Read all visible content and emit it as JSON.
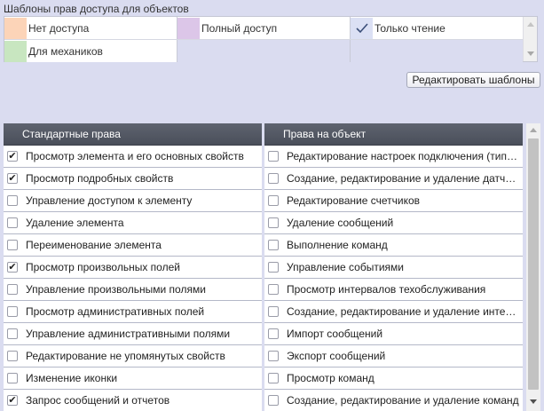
{
  "templates_section": {
    "title": "Шаблоны прав доступа для объектов",
    "rows": [
      [
        {
          "label": "Нет доступа",
          "color": "#fcd4b8",
          "checked": false
        },
        {
          "label": "Полный доступ",
          "color": "#dcc6e8",
          "checked": false
        },
        {
          "label": "Только чтение",
          "color": "#dbe0f4",
          "checked": true
        }
      ],
      [
        {
          "label": "Для механиков",
          "color": "#c8e6c0",
          "checked": false
        },
        null,
        null
      ]
    ],
    "edit_button_label": "Редактировать шаблоны"
  },
  "rights_table": {
    "left_column": {
      "header": "Стандартные права",
      "items": [
        {
          "label": "Просмотр элемента и его основных свойств",
          "checked": true
        },
        {
          "label": "Просмотр подробных свойств",
          "checked": true
        },
        {
          "label": "Управление доступом к элементу",
          "checked": false
        },
        {
          "label": "Удаление элемента",
          "checked": false
        },
        {
          "label": "Переименование элемента",
          "checked": false
        },
        {
          "label": "Просмотр произвольных полей",
          "checked": true
        },
        {
          "label": "Управление произвольными полями",
          "checked": false
        },
        {
          "label": "Просмотр административных полей",
          "checked": false
        },
        {
          "label": "Управление административными полями",
          "checked": false
        },
        {
          "label": "Редактирование не упомянутых свойств",
          "checked": false
        },
        {
          "label": "Изменение иконки",
          "checked": false
        },
        {
          "label": "Запрос сообщений и отчетов",
          "checked": true
        }
      ]
    },
    "right_column": {
      "header": "Права на объект",
      "items": [
        {
          "label": "Редактирование настроек подключения (тип …",
          "checked": false
        },
        {
          "label": "Создание, редактирование и удаление датч…",
          "checked": false
        },
        {
          "label": "Редактирование счетчиков",
          "checked": false
        },
        {
          "label": "Удаление сообщений",
          "checked": false
        },
        {
          "label": "Выполнение команд",
          "checked": false
        },
        {
          "label": "Управление событиями",
          "checked": false
        },
        {
          "label": "Просмотр интервалов техобслуживания",
          "checked": false
        },
        {
          "label": "Создание, редактирование и удаление инте…",
          "checked": false
        },
        {
          "label": "Импорт сообщений",
          "checked": false
        },
        {
          "label": "Экспорт сообщений",
          "checked": false
        },
        {
          "label": "Просмотр команд",
          "checked": false
        },
        {
          "label": "Создание, редактирование и удаление команд",
          "checked": false
        }
      ]
    }
  },
  "check_glyph": "✔",
  "tick_color": "#3a4e78"
}
